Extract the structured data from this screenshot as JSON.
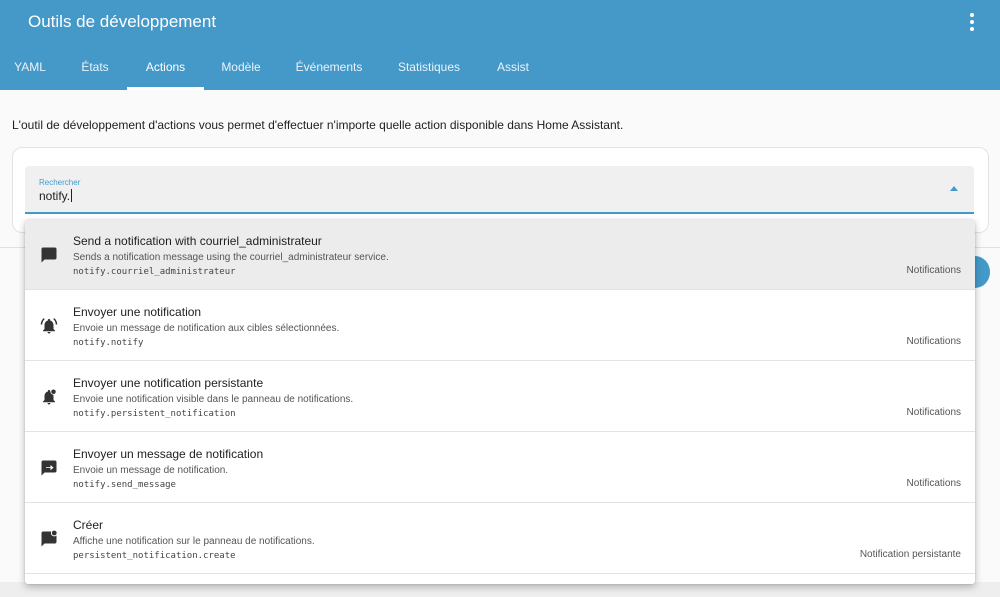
{
  "header": {
    "title": "Outils de développement",
    "menu_icon": "more-vertical-icon"
  },
  "tabs": [
    {
      "label": "YAML"
    },
    {
      "label": "États"
    },
    {
      "label": "Actions",
      "active": true
    },
    {
      "label": "Modèle"
    },
    {
      "label": "Événements"
    },
    {
      "label": "Statistiques"
    },
    {
      "label": "Assist"
    }
  ],
  "description": "L'outil de développement d'actions vous permet d'effectuer n'importe quelle action disponible dans Home Assistant.",
  "search": {
    "label": "Rechercher",
    "value": "notify."
  },
  "results": [
    {
      "icon": "message-icon",
      "title": "Send a notification with courriel_administrateur",
      "description": "Sends a notification message using the courriel_administrateur service.",
      "action_id": "notify.courriel_administrateur",
      "category": "Notifications",
      "highlighted": true
    },
    {
      "icon": "bell-ring-icon",
      "title": "Envoyer une notification",
      "description": "Envoie un message de notification aux cibles sélectionnées.",
      "action_id": "notify.notify",
      "category": "Notifications"
    },
    {
      "icon": "bell-badge-icon",
      "title": "Envoyer une notification persistante",
      "description": "Envoie une notification visible dans le panneau de notifications.",
      "action_id": "notify.persistent_notification",
      "category": "Notifications"
    },
    {
      "icon": "message-arrow-right-icon",
      "title": "Envoyer un message de notification",
      "description": "Envoie un message de notification.",
      "action_id": "notify.send_message",
      "category": "Notifications"
    },
    {
      "icon": "message-badge-icon",
      "title": "Créer",
      "description": "Affiche une notification sur le panneau de notifications.",
      "action_id": "persistent_notification.create",
      "category": "Notification persistante"
    }
  ],
  "colors": {
    "primary": "#4499c9",
    "highlight_row": "#ececec"
  }
}
